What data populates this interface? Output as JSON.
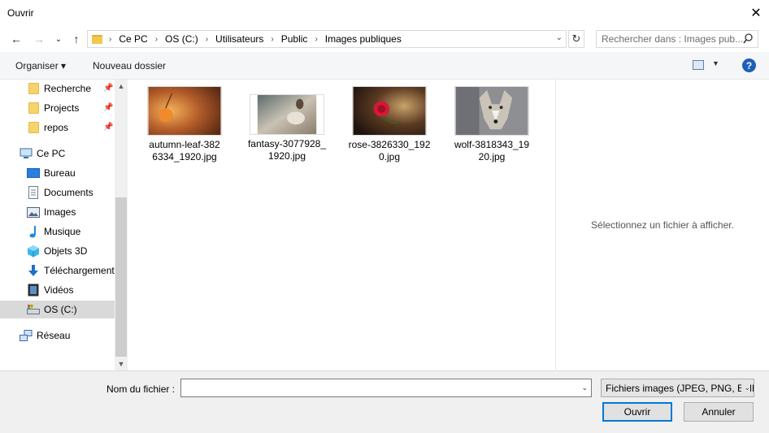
{
  "window": {
    "title": "Ouvrir",
    "close_glyph": "✕"
  },
  "nav": {
    "back_glyph": "←",
    "forward_glyph": "→",
    "recent_glyph": "⌄",
    "up_glyph": "↑",
    "breadcrumbs": [
      "Ce PC",
      "OS (C:)",
      "Utilisateurs",
      "Public",
      "Images publiques"
    ],
    "separator": "›",
    "dropdown_glyph": "⌄",
    "refresh_glyph": "↻",
    "search_placeholder": "Rechercher dans : Images pub..."
  },
  "toolbar": {
    "organize_label": "Organiser ▾",
    "new_folder_label": "Nouveau dossier",
    "view_dd_glyph": "▼",
    "help_glyph": "?"
  },
  "sidebar": {
    "quick_access": [
      {
        "label": "Recherche",
        "pin": "📌"
      },
      {
        "label": "Projects",
        "pin": "📌"
      },
      {
        "label": "repos",
        "pin": "📌"
      }
    ],
    "this_pc": "Ce PC",
    "pc_items": [
      {
        "label": "Bureau",
        "icon": "desktop-icon"
      },
      {
        "label": "Documents",
        "icon": "documents-icon"
      },
      {
        "label": "Images",
        "icon": "pictures-icon"
      },
      {
        "label": "Musique",
        "icon": "music-icon"
      },
      {
        "label": "Objets 3D",
        "icon": "3d-objects-icon"
      },
      {
        "label": "Téléchargements",
        "icon": "downloads-icon"
      },
      {
        "label": "Vidéos",
        "icon": "videos-icon"
      },
      {
        "label": "OS (C:)",
        "icon": "drive-icon",
        "selected": true
      }
    ],
    "network": "Réseau",
    "scroll_up_glyph": "▲",
    "scroll_down_glyph": "▼"
  },
  "files": [
    {
      "name_line1": "autumn-leaf-382",
      "name_line2": "6334_1920.jpg",
      "thumb": "autumn-leaf-thumbnail"
    },
    {
      "name_line1": "fantasy-3077928_",
      "name_line2": "1920.jpg",
      "thumb": "fantasy-thumbnail"
    },
    {
      "name_line1": "rose-3826330_192",
      "name_line2": "0.jpg",
      "thumb": "rose-thumbnail"
    },
    {
      "name_line1": "wolf-3818343_19",
      "name_line2": "20.jpg",
      "thumb": "wolf-thumbnail"
    }
  ],
  "preview": {
    "message": "Sélectionnez un fichier à afficher."
  },
  "footer": {
    "filename_label": "Nom du fichier :",
    "filename_value": "",
    "dropdown_glyph": "⌄",
    "filter_value": "Fichiers images (JPEG, PNG, BMP",
    "open_label": "Ouvrir",
    "cancel_label": "Annuler"
  },
  "colors": {
    "accent": "#0078d7",
    "selection": "#d9d9d9",
    "help": "#1e5fb8"
  }
}
